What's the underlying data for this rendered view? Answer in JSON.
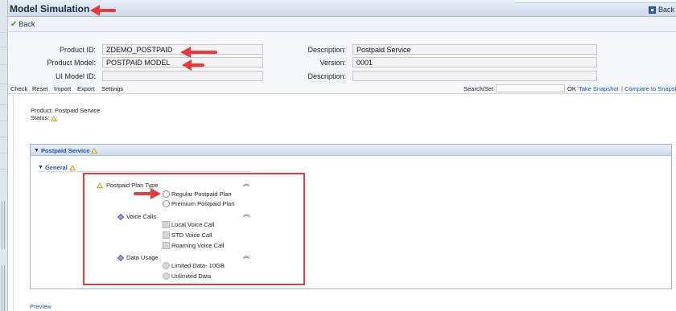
{
  "window": {
    "title": "Model Simulation",
    "back_top_label": "Back",
    "back_label": "Back"
  },
  "form": {
    "product_id": {
      "label": "Product ID:",
      "value": "ZDEMO_POSTPAID"
    },
    "product_model": {
      "label": "Product Model:",
      "value": "POSTPAID MODEL"
    },
    "ui_model_id": {
      "label": "UI Model ID:",
      "value": ""
    },
    "description1": {
      "label": "Description:",
      "value": "Postpaid Service"
    },
    "version": {
      "label": "Version:",
      "value": "0001"
    },
    "description2": {
      "label": "Description:",
      "value": ""
    }
  },
  "menu": {
    "items": [
      "Check",
      "Reset",
      "Import",
      "Export",
      "Settings"
    ],
    "search_label": "Search/Set",
    "ok_label": "OK",
    "take_snapshot": "Take Snapshot",
    "separator": "|",
    "compare": "Compare to Snapshot"
  },
  "info": {
    "product": "Product: Postpaid Service",
    "status_label": "Status:"
  },
  "panel": {
    "title": "Postpaid Service",
    "section": "General"
  },
  "characteristics": {
    "plan_type": {
      "label": "Postpaid Plan Type",
      "options": [
        "Regular Postpaid Plan",
        "Premium Postpaid Plan"
      ]
    },
    "voice_calls": {
      "label": "Voice Calls",
      "options": [
        "Local Voice Call",
        "STD Voice Call",
        "Roaming Voice Call"
      ]
    },
    "data_usage": {
      "label": "Data Usage",
      "options": [
        "Limited Data- 10GB",
        "Unlimited Data"
      ]
    }
  },
  "footer": {
    "preview": "Preview"
  },
  "colors": {
    "link": "#1f55a8",
    "annotation_red": "#e53d3d",
    "warning_yellow": "#d4a017",
    "header_blue": "#cdd9e8"
  },
  "icons": {
    "status": "warning-triangle-icon",
    "required": "diamond-icon",
    "collapse": "double-chevron-up-icon"
  }
}
